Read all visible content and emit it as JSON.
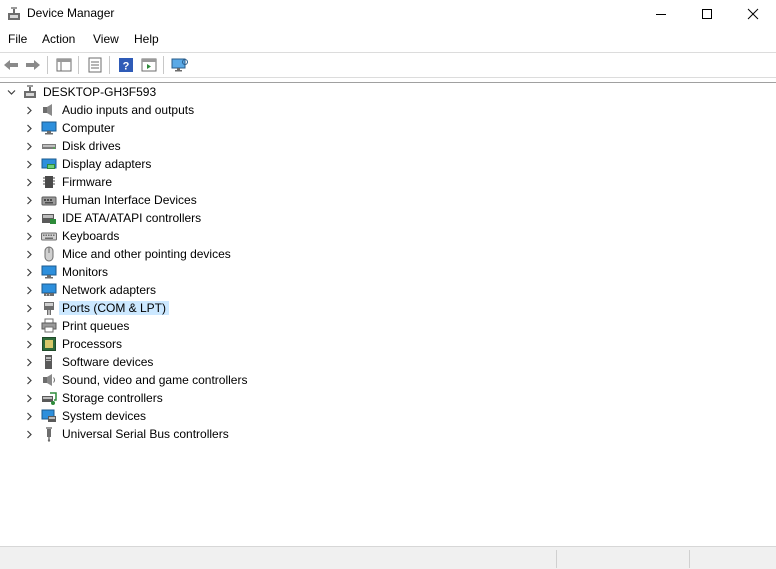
{
  "window": {
    "title": "Device Manager"
  },
  "menu": [
    "File",
    "Action",
    "View",
    "Help"
  ],
  "toolbar": [
    "back",
    "forward",
    "properties-list",
    "update",
    "help",
    "run",
    "monitor"
  ],
  "tree": {
    "root": "DESKTOP-GH3F593",
    "items": [
      {
        "label": "Audio inputs and outputs",
        "icon": "speaker-icon"
      },
      {
        "label": "Computer",
        "icon": "computer-icon"
      },
      {
        "label": "Disk drives",
        "icon": "disk-drive-icon"
      },
      {
        "label": "Display adapters",
        "icon": "display-adapter-icon"
      },
      {
        "label": "Firmware",
        "icon": "firmware-chip-icon"
      },
      {
        "label": "Human Interface Devices",
        "icon": "hid-icon"
      },
      {
        "label": "IDE ATA/ATAPI controllers",
        "icon": "ide-controller-icon"
      },
      {
        "label": "Keyboards",
        "icon": "keyboard-icon"
      },
      {
        "label": "Mice and other pointing devices",
        "icon": "mouse-icon"
      },
      {
        "label": "Monitors",
        "icon": "monitor-icon"
      },
      {
        "label": "Network adapters",
        "icon": "network-adapter-icon"
      },
      {
        "label": "Ports (COM & LPT)",
        "icon": "port-icon",
        "selected": true
      },
      {
        "label": "Print queues",
        "icon": "printer-icon"
      },
      {
        "label": "Processors",
        "icon": "processor-icon"
      },
      {
        "label": "Software devices",
        "icon": "software-device-icon"
      },
      {
        "label": "Sound, video and game controllers",
        "icon": "sound-icon"
      },
      {
        "label": "Storage controllers",
        "icon": "storage-controller-icon"
      },
      {
        "label": "System devices",
        "icon": "system-device-icon"
      },
      {
        "label": "Universal Serial Bus controllers",
        "icon": "usb-icon"
      }
    ]
  },
  "colors": {
    "selection": "#cce8ff",
    "accent_blue": "#1e73be",
    "status_bg": "#f0f0f0"
  }
}
